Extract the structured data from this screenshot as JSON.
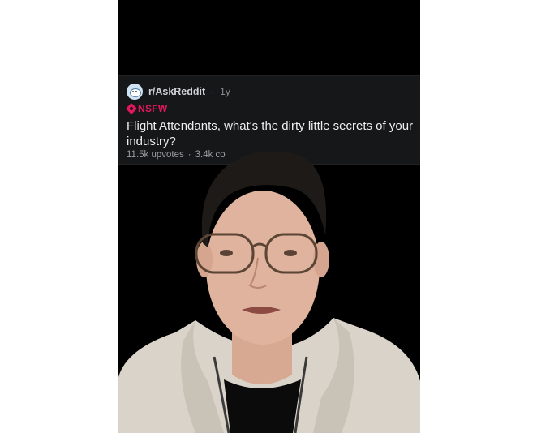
{
  "post": {
    "subreddit": "r/AskReddit",
    "separator": "·",
    "age": "1y",
    "nsfw_label": "NSFW",
    "title": "Flight Attendants, what's the dirty little secrets of your industry?",
    "upvotes": "11.5k upvotes",
    "meta_separator": "·",
    "comments": "3.4k co"
  },
  "colors": {
    "background": "#000000",
    "card": "#161718",
    "nsfw": "#e0175a",
    "jacket": "#d8d2c8"
  },
  "icons": {
    "subreddit_avatar": "askreddit-avatar-icon",
    "nsfw": "nsfw-icon"
  }
}
